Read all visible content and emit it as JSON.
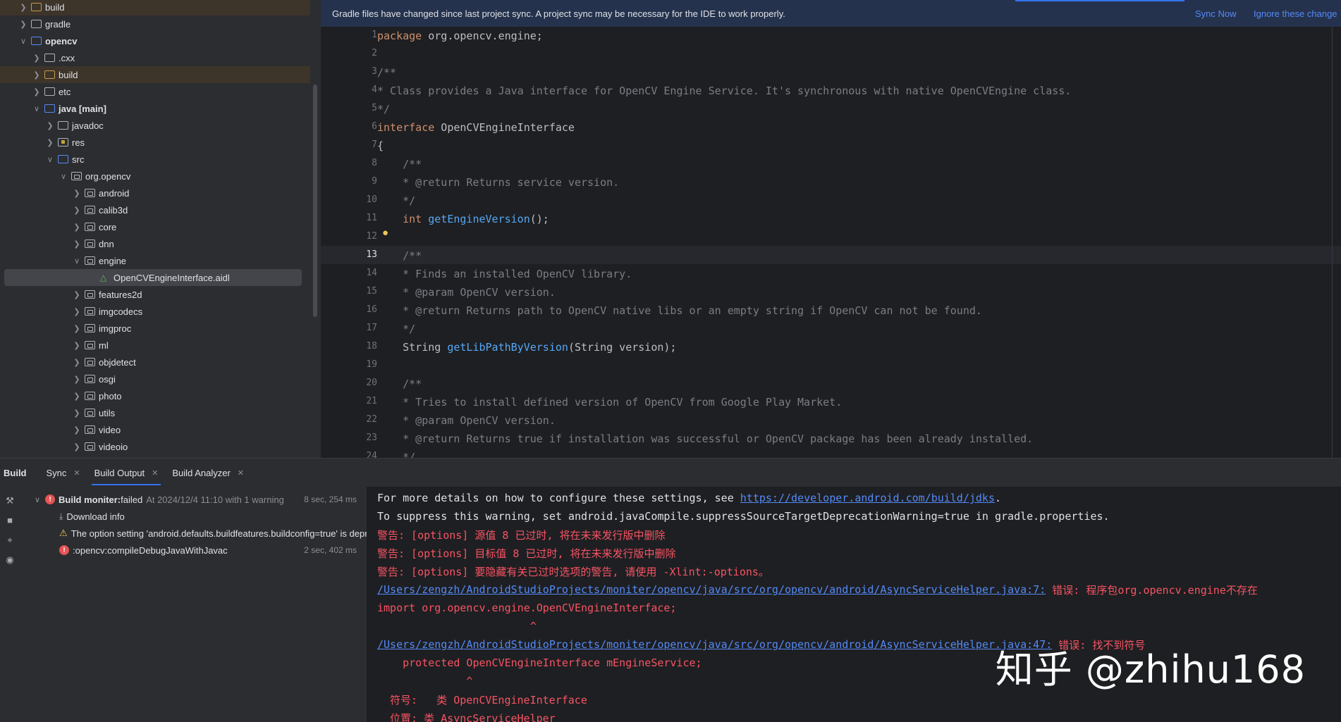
{
  "tree": {
    "items": [
      {
        "label": "build",
        "icon": "folder-build-icon"
      },
      {
        "label": "gradle",
        "icon": "folder-icon"
      },
      {
        "label": "opencv",
        "icon": "module-folder-icon"
      },
      {
        "label": ".cxx",
        "icon": "folder-icon"
      },
      {
        "label": "build",
        "icon": "folder-build-icon"
      },
      {
        "label": "etc",
        "icon": "folder-icon"
      },
      {
        "label": "java [main]",
        "icon": "source-folder-icon"
      },
      {
        "label": "javadoc",
        "icon": "folder-icon"
      },
      {
        "label": "res",
        "icon": "resource-folder-icon"
      },
      {
        "label": "src",
        "icon": "source-folder-icon"
      },
      {
        "label": "org.opencv",
        "icon": "package-icon"
      },
      {
        "label": "android",
        "icon": "package-icon"
      },
      {
        "label": "calib3d",
        "icon": "package-icon"
      },
      {
        "label": "core",
        "icon": "package-icon"
      },
      {
        "label": "dnn",
        "icon": "package-icon"
      },
      {
        "label": "engine",
        "icon": "package-icon"
      },
      {
        "label": "OpenCVEngineInterface.aidl",
        "icon": "aidl-file-icon"
      },
      {
        "label": "features2d",
        "icon": "package-icon"
      },
      {
        "label": "imgcodecs",
        "icon": "package-icon"
      },
      {
        "label": "imgproc",
        "icon": "package-icon"
      },
      {
        "label": "ml",
        "icon": "package-icon"
      },
      {
        "label": "objdetect",
        "icon": "package-icon"
      },
      {
        "label": "osgi",
        "icon": "package-icon"
      },
      {
        "label": "photo",
        "icon": "package-icon"
      },
      {
        "label": "utils",
        "icon": "package-icon"
      },
      {
        "label": "video",
        "icon": "package-icon"
      },
      {
        "label": "videoio",
        "icon": "package-icon"
      }
    ]
  },
  "banner": {
    "message": "Gradle files have changed since last project sync. A project sync may be necessary for the IDE to work properly.",
    "sync_now": "Sync Now",
    "ignore": "Ignore these change"
  },
  "editor": {
    "current_line": "13",
    "line_numbers": [
      "1",
      "2",
      "3",
      "4",
      "5",
      "6",
      "7",
      "8",
      "9",
      "10",
      "11",
      "12",
      "13",
      "14",
      "15",
      "16",
      "17",
      "18",
      "19",
      "20",
      "21",
      "22",
      "23",
      "24"
    ],
    "lines": {
      "l1_kw": "package",
      "l1_rest": " org.opencv.engine;",
      "l3": "/**",
      "l4": "* Class provides a Java interface for OpenCV Engine Service. It's synchronous with native OpenCVEngine class.",
      "l5": "*/",
      "l6_kw": "interface",
      "l6_rest": " OpenCVEngineInterface",
      "l7": "{",
      "l8": "    /**",
      "l9": "    * @return Returns service version.",
      "l10": "    */",
      "l11_kw": "    int ",
      "l11_fn": "getEngineVersion",
      "l11_rest": "();",
      "l13": "    /**",
      "l14": "    * Finds an installed OpenCV library.",
      "l15": "    * @param OpenCV version.",
      "l16": "    * @return Returns path to OpenCV native libs or an empty string if OpenCV can not be found.",
      "l17": "    */",
      "l18_pre": "    String ",
      "l18_fn": "getLibPathByVersion",
      "l18_rest": "(String version);",
      "l20": "    /**",
      "l21": "    * Tries to install defined version of OpenCV from Google Play Market.",
      "l22": "    * @param OpenCV version.",
      "l23": "    * @return Returns true if installation was successful or OpenCV package has been already installed.",
      "l24": "    */"
    }
  },
  "bottom": {
    "title": "Build",
    "tabs": [
      {
        "label": "Sync"
      },
      {
        "label": "Build Output"
      },
      {
        "label": "Build Analyzer"
      }
    ],
    "build_tree": {
      "root_bold": "Build moniter:",
      "root_status": " failed",
      "root_detail": "At 2024/12/4 11:10 with 1 warning",
      "root_time": "8 sec, 254 ms",
      "download": "Download info",
      "warning": "The option setting 'android.defaults.buildfeatures.buildconfig=true' is deprecated.",
      "task": ":opencv:compileDebugJavaWithJavac",
      "task_time": "2 sec, 402 ms"
    },
    "output": {
      "l1_pre": "For more details on how to configure these settings, see ",
      "l1_link": "https://developer.android.com/build/jdks",
      "l1_post": ".",
      "l2": "To suppress this warning, set android.javaCompile.suppressSourceTargetDeprecationWarning=true in gradle.properties.",
      "l3": "警告: [options] 源值 8 已过时, 将在未来发行版中删除",
      "l4": "警告: [options] 目标值 8 已过时, 将在未来发行版中删除",
      "l5": "警告: [options] 要隐藏有关已过时选项的警告, 请使用 -Xlint:-options。",
      "l6_link": "/Users/zengzh/AndroidStudioProjects/moniter/opencv/java/src/org/opencv/android/AsyncServiceHelper.java:7:",
      "l6_rest": " 错误: 程序包org.opencv.engine不存在",
      "l7": "import org.opencv.engine.OpenCVEngineInterface;",
      "l8": "                        ^",
      "l9_link": "/Users/zengzh/AndroidStudioProjects/moniter/opencv/java/src/org/opencv/android/AsyncServiceHelper.java:47:",
      "l9_rest": " 错误: 找不到符号",
      "l10": "    protected OpenCVEngineInterface mEngineService;",
      "l11": "              ^",
      "l12": "  符号:   类 OpenCVEngineInterface",
      "l13": "  位置: 类 AsyncServiceHelper"
    }
  },
  "watermark": "知乎 @zhihu168",
  "colors": {
    "accent": "#3574f0",
    "error": "#f75464",
    "link": "#548af7",
    "keyword": "#cf8e6d",
    "function": "#56a8f5",
    "comment": "#7a7e85"
  }
}
